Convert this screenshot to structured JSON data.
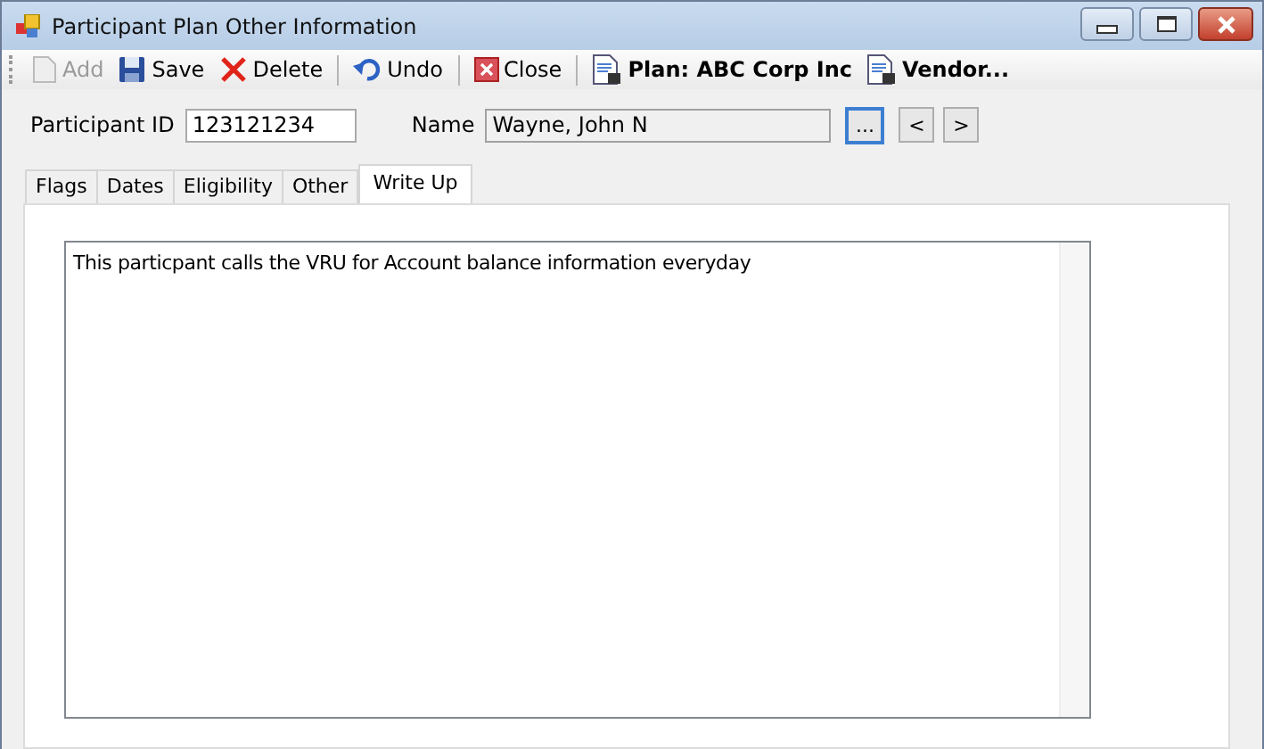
{
  "window": {
    "title": "Participant Plan Other Information"
  },
  "toolbar": [
    {
      "kind": "button",
      "label": "Add",
      "disabled": true,
      "bold": false
    },
    {
      "kind": "button",
      "label": "Save",
      "disabled": false,
      "bold": false
    },
    {
      "kind": "button",
      "label": "Delete",
      "disabled": false,
      "bold": false
    },
    {
      "kind": "separator"
    },
    {
      "kind": "button",
      "label": "Undo",
      "disabled": false,
      "bold": false
    },
    {
      "kind": "separator"
    },
    {
      "kind": "button",
      "label": "Close",
      "disabled": false,
      "bold": false
    },
    {
      "kind": "separator"
    },
    {
      "kind": "button",
      "label": "Plan: ABC Corp Inc",
      "disabled": false,
      "bold": true
    },
    {
      "kind": "button",
      "label": "Vendor...",
      "disabled": false,
      "bold": true
    }
  ],
  "participant_id": {
    "label": "Participant ID",
    "value": "123121234"
  },
  "name": {
    "label": "Name",
    "value": "Wayne, John N",
    "browse": "...",
    "prev": "<",
    "next": ">"
  },
  "tabs": [
    {
      "label": "Flags",
      "selected": false
    },
    {
      "label": "Dates",
      "selected": false
    },
    {
      "label": "Eligibility",
      "selected": false
    },
    {
      "label": "Other",
      "selected": false
    },
    {
      "label": "Write Up",
      "selected": true
    }
  ],
  "write_up": {
    "value": "This particpant calls the VRU for Account balance information everyday"
  }
}
